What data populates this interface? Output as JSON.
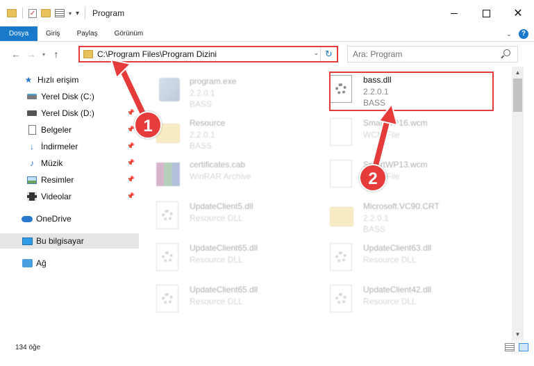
{
  "window": {
    "title": "Program",
    "controls": {
      "minimize": "",
      "maximize": "",
      "close": "✕"
    }
  },
  "ribbon": {
    "tabs": [
      "Dosya",
      "Giriş",
      "Paylaş",
      "Görünüm"
    ],
    "help": "?"
  },
  "nav": {
    "address": "C:\\Program Files\\Program Dizini",
    "search_placeholder": "Ara: Program"
  },
  "sidebar": {
    "items": [
      {
        "label": "Hızlı erişim",
        "icon": "star-icon",
        "pinned": false
      },
      {
        "label": "Yerel Disk (C:)",
        "icon": "drive-icon",
        "pinned": false
      },
      {
        "label": "Yerel Disk (D:)",
        "icon": "drive-icon",
        "pinned": true
      },
      {
        "label": "Belgeler",
        "icon": "document-icon",
        "pinned": true
      },
      {
        "label": "İndirmeler",
        "icon": "download-icon",
        "pinned": true
      },
      {
        "label": "Müzik",
        "icon": "music-icon",
        "pinned": true
      },
      {
        "label": "Resimler",
        "icon": "pictures-icon",
        "pinned": true
      },
      {
        "label": "Videolar",
        "icon": "videos-icon",
        "pinned": true
      },
      {
        "label": "OneDrive",
        "icon": "cloud-icon",
        "pinned": false
      },
      {
        "label": "Bu bilgisayar",
        "icon": "computer-icon",
        "pinned": false,
        "selected": true
      },
      {
        "label": "Ağ",
        "icon": "network-icon",
        "pinned": false
      }
    ]
  },
  "files": [
    {
      "name": "program.exe",
      "line2": "2.2.0.1",
      "line3": "BASS",
      "type": "exe",
      "faded": true
    },
    {
      "name": "bass.dll",
      "line2": "2.2.0.1",
      "line3": "BASS",
      "type": "dll",
      "faded": false,
      "highlighted": true
    },
    {
      "name": "Resource",
      "line2": "2.2.0.1",
      "line3": "BASS",
      "type": "folder",
      "faded": true
    },
    {
      "name": "SmartWP16.wcm",
      "line2": "WCM File",
      "line3": "",
      "type": "page",
      "faded": true
    },
    {
      "name": "certificates.cab",
      "line2": "WinRAR Archive",
      "line3": "",
      "type": "rar",
      "faded": true
    },
    {
      "name": "SmartWP13.wcm",
      "line2": "WCM File",
      "line3": "",
      "type": "page",
      "faded": true
    },
    {
      "name": "UpdateClient5.dll",
      "line2": "Resource DLL",
      "line3": "",
      "type": "dll",
      "faded": true
    },
    {
      "name": "Microsoft.VC90.CRT",
      "line2": "2.2.0.1",
      "line3": "BASS",
      "type": "folder",
      "faded": true
    },
    {
      "name": "UpdateClient65.dll",
      "line2": "Resource DLL",
      "line3": "",
      "type": "dll",
      "faded": true
    },
    {
      "name": "UpdateClient63.dll",
      "line2": "Resource DLL",
      "line3": "",
      "type": "dll",
      "faded": true
    },
    {
      "name": "UpdateClient65.dll",
      "line2": "Resource DLL",
      "line3": "",
      "type": "dll",
      "faded": true
    },
    {
      "name": "UpdateClient42.dll",
      "line2": "Resource DLL",
      "line3": "",
      "type": "dll",
      "faded": true
    }
  ],
  "status": {
    "count": "134 öğe"
  },
  "annotations": {
    "step1": "1",
    "step2": "2",
    "color": "#e53b3b"
  }
}
